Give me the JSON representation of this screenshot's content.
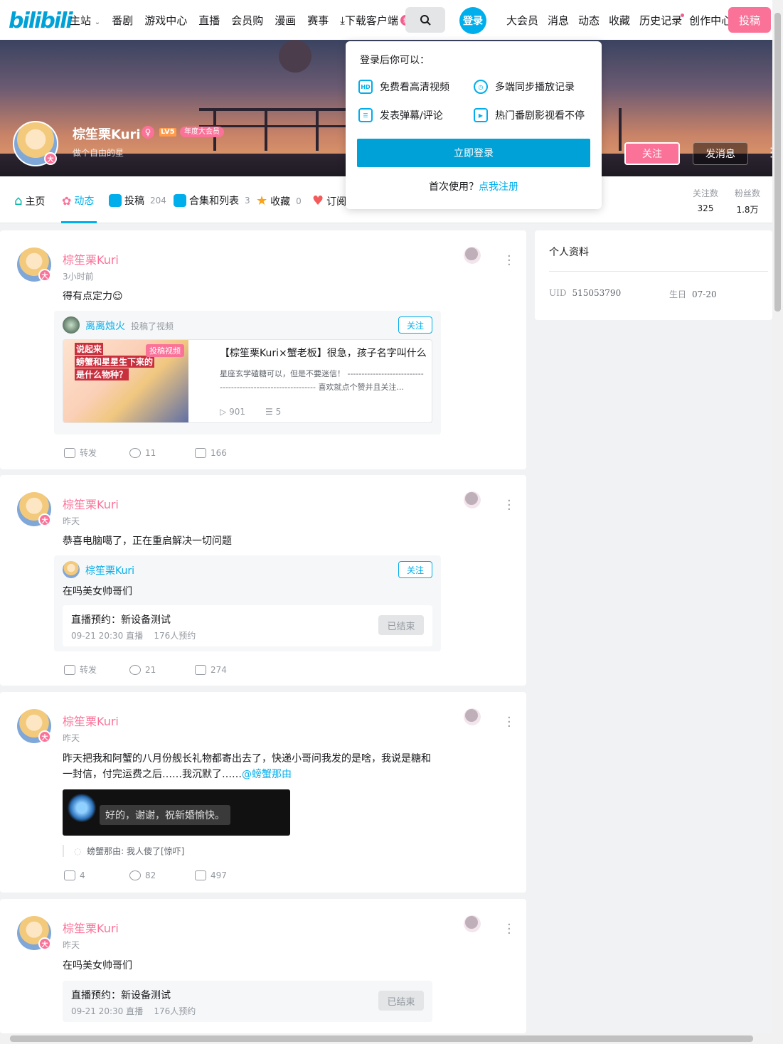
{
  "nav": {
    "logo": "bilibili",
    "left_items": [
      "主站",
      "番剧",
      "游戏中心",
      "直播",
      "会员购",
      "漫画",
      "赛事"
    ],
    "download": "下载客户端",
    "download_badge": "新",
    "login": "登录",
    "right_items": [
      "大会员",
      "消息",
      "动态",
      "收藏",
      "历史记录",
      "创作中心"
    ],
    "upload": "投稿"
  },
  "profile": {
    "name": "棕笙栗Kuri",
    "gender_symbol": "♀",
    "level": "LV5",
    "vip_label": "年度大会员",
    "vip_badge": "大",
    "sign": "做个自由的星",
    "follow": "关注",
    "message": "发消息"
  },
  "tabs": [
    {
      "label": "主页",
      "count": ""
    },
    {
      "label": "动态",
      "count": ""
    },
    {
      "label": "投稿",
      "count": "204"
    },
    {
      "label": "合集和列表",
      "count": "3"
    },
    {
      "label": "收藏",
      "count": "0"
    },
    {
      "label": "订阅",
      "count": ""
    }
  ],
  "stats": {
    "following_label": "关注数",
    "following": "325",
    "fans_label": "粉丝数",
    "fans": "1.8万"
  },
  "popover": {
    "title": "登录后你可以：",
    "features": [
      "免费看高清视频",
      "多端同步播放记录",
      "发表弹幕/评论",
      "热门番剧影视看不停"
    ],
    "hd_icon": "HD",
    "login_button": "立即登录",
    "first_use": "首次使用？",
    "register": "点我注册"
  },
  "feed": [
    {
      "name": "棕笙栗Kuri",
      "time": "3小时前",
      "text": "得有点定力😌",
      "inner": {
        "name": "离离烛火",
        "action": "投稿了视频",
        "follow": "关注",
        "video_tag": "投稿视频",
        "thumb_lines": [
          "说起来",
          "螃蟹和星星生下来的",
          "是什么物种？"
        ],
        "title": "【棕笙栗Kuri×蟹老板】很急，孩子名字叫什么",
        "desc": "星座玄学磕糖可以，但是不要迷信！ ------------------------------------------------------------- 喜欢就点个赞并且关注...",
        "plays": "901",
        "danmaku": "5"
      },
      "forward": "转发",
      "comments": "11",
      "likes": "166"
    },
    {
      "name": "棕笙栗Kuri",
      "time": "昨天",
      "text": "恭喜电脑噶了，正在重启解决一切问题",
      "inner": {
        "name": "棕笙栗Kuri",
        "follow": "关注",
        "text": "在吗美女帅哥们",
        "live_title": "直播预约：新设备测试",
        "live_time": "09-21 20:30 直播",
        "live_reserve": "176人预约",
        "ended": "已结束"
      },
      "forward": "转发",
      "comments": "21",
      "likes": "274"
    },
    {
      "name": "棕笙栗Kuri",
      "time": "昨天",
      "text_main": "昨天把我和阿蟹的八月份舰长礼物都寄出去了，快递小哥问我发的是啥，我说是糖和一封信，付完运费之后……我沉默了……",
      "mention": "@螃蟹那由",
      "image_text": "好的，谢谢，祝新婚愉快。",
      "comment_user": "螃蟹那由:",
      "comment_text": "我人傻了[惊吓]",
      "forward": "4",
      "comments": "82",
      "likes": "497"
    },
    {
      "name": "棕笙栗Kuri",
      "time": "昨天",
      "text": "在吗美女帅哥们",
      "live_title": "直播预约：新设备测试",
      "live_time": "09-21 20:30 直播",
      "live_reserve": "176人预约",
      "ended": "已结束"
    }
  ],
  "side": {
    "title": "个人资料",
    "uid_label": "UID",
    "uid": "515053790",
    "birthday_label": "生日",
    "birthday": "07-20"
  },
  "colors": {
    "brand": "#00aeec",
    "pink": "#fb7299"
  }
}
